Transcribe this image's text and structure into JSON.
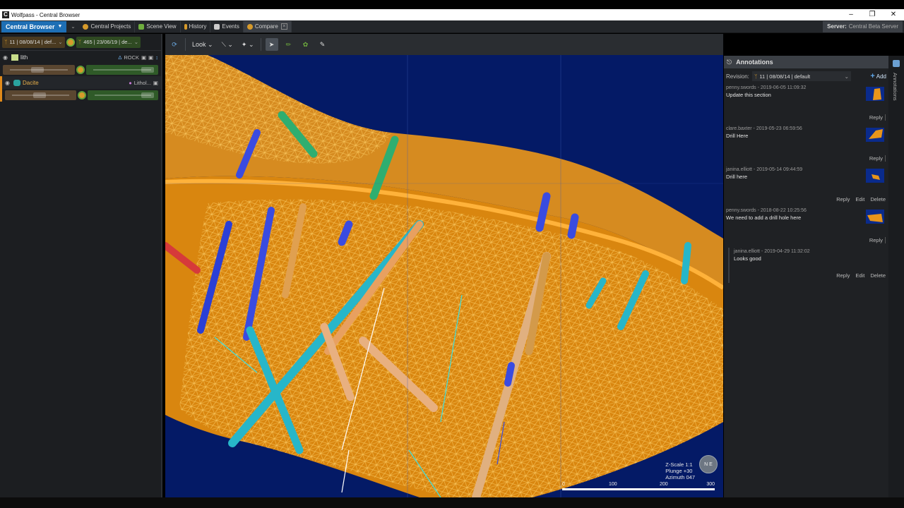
{
  "window": {
    "title": "Wolfpass - Central Browser",
    "icon": "app-logo-icon",
    "controls": [
      "minimize-icon",
      "restore-icon",
      "close-icon"
    ]
  },
  "topbar": {
    "brand": "Central Browser",
    "tabs": [
      {
        "label": "Central Projects",
        "icon": "projects-icon",
        "color": "#d69a2b"
      },
      {
        "label": "Scene View",
        "icon": "scene-cube-icon",
        "color": "#6fae3e"
      },
      {
        "label": "History",
        "icon": "history-branch-icon",
        "color": "#d69a2b"
      },
      {
        "label": "Events",
        "icon": "events-doc-icon",
        "color": "#cccccc"
      },
      {
        "label": "Compare",
        "icon": "compare-icon",
        "color": "#d69a2b"
      }
    ],
    "server_label": "Server:",
    "server_name": "Central Beta Server"
  },
  "leftpanel": {
    "rev_left": "11 | 08/08/14 | def...",
    "rev_right": "465 | 23/06/19 | de...",
    "layers": [
      {
        "name": "lith",
        "right_label": "ROCK",
        "name_color": "#cfcfcf",
        "swatch": "#c8dd8a"
      },
      {
        "name": "Dacite",
        "right_label": "Lithol...",
        "name_color": "#e8b04a",
        "swatch": "#2aa3a0"
      }
    ]
  },
  "viewport": {
    "toolbar": {
      "look_label": "Look"
    },
    "hud": {
      "z_scale": "Z-Scale 1:1",
      "plunge": "Plunge +30",
      "azimuth": "Azimuth 047"
    },
    "scale_labels": [
      "0",
      "100",
      "200",
      "300"
    ]
  },
  "annotations": {
    "title": "Annotations",
    "revision_label": "Revision:",
    "revision_value": "11 | 08/08/14 | default",
    "add_label": "Add",
    "items": [
      {
        "author": "penny.swords",
        "time": "2019-06-05 11:09:32",
        "text": "Update this section",
        "reply": "Reply",
        "edit": "",
        "delete": ""
      },
      {
        "author": "clare.baxter",
        "time": "2019-05-23 06:59:56",
        "text": "Drill Here",
        "reply": "Reply",
        "edit": "",
        "delete": ""
      },
      {
        "author": "janina.elliott",
        "time": "2019-05-14 09:44:59",
        "text": "Drill here",
        "reply": "Reply",
        "edit": "Edit",
        "delete": "Delete"
      },
      {
        "author": "penny.swords",
        "time": "2018-08-22 10:25:56",
        "text": "We need to add a drill hole here",
        "reply": "Reply",
        "edit": "",
        "delete": ""
      }
    ],
    "reply_item": {
      "author": "janina.elliott",
      "time": "2019-04-29 11:32:02",
      "text": "Looks good",
      "reply": "Reply",
      "edit": "Edit",
      "delete": "Delete"
    },
    "side_tab": "Annotations"
  },
  "colors": {
    "brand": "#1e6fb5",
    "scene_bg": "#041a66",
    "orebody": "#e8951a",
    "wire": "#f5b84a"
  }
}
